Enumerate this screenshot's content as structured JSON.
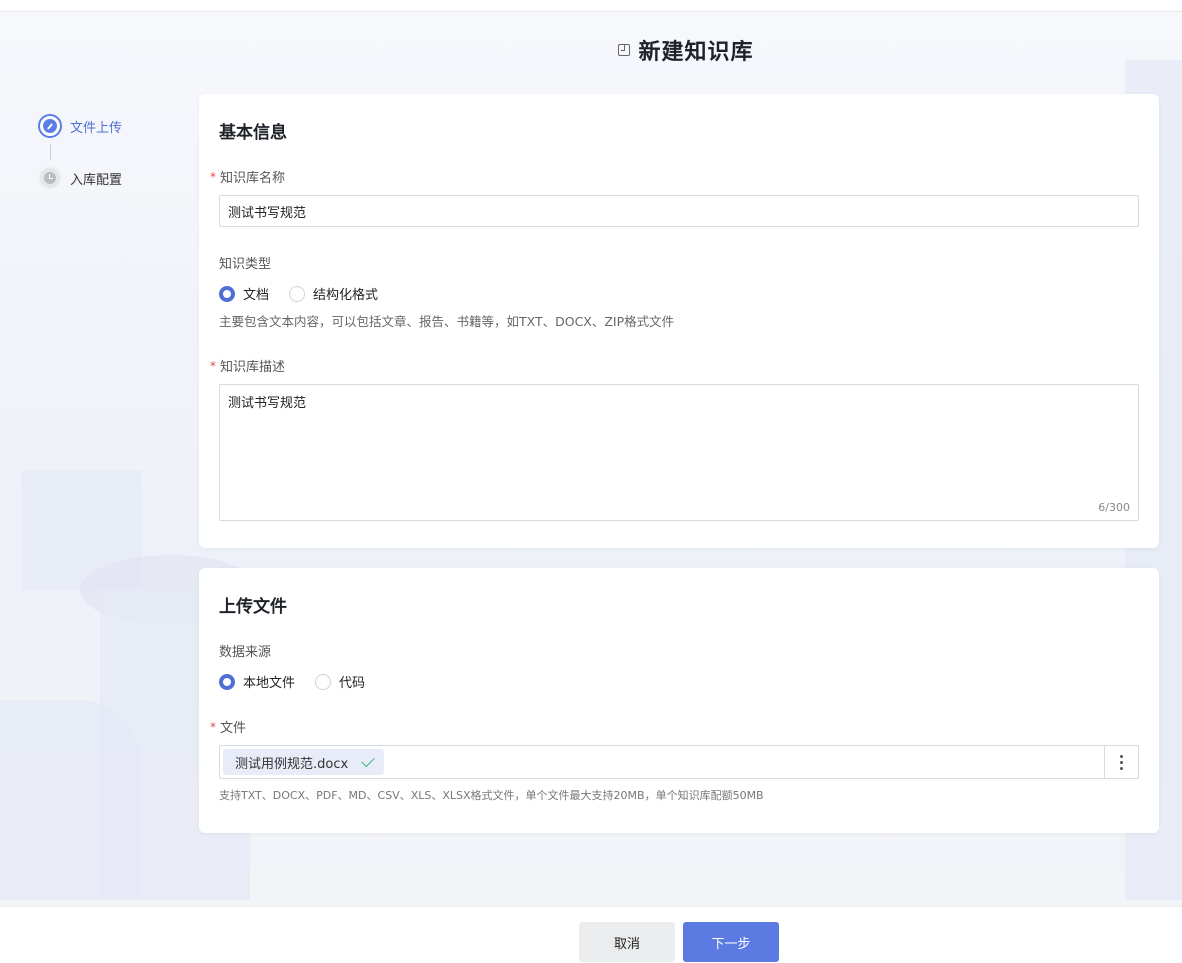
{
  "page": {
    "title": "新建知识库"
  },
  "steps": [
    {
      "label": "文件上传",
      "state": "active",
      "icon": "pencil-icon"
    },
    {
      "label": "入库配置",
      "state": "pending",
      "icon": "clock-icon"
    }
  ],
  "basic_info": {
    "heading": "基本信息",
    "name": {
      "label": "知识库名称",
      "required_mark": "*",
      "value": "测试书写规范"
    },
    "type": {
      "label": "知识类型",
      "options": [
        {
          "label": "文档",
          "checked": true
        },
        {
          "label": "结构化格式",
          "checked": false
        }
      ],
      "hint": "主要包含文本内容，可以包括文章、报告、书籍等，如TXT、DOCX、ZIP格式文件"
    },
    "description": {
      "label": "知识库描述",
      "required_mark": "*",
      "value": "测试书写规范",
      "counter": "6/300"
    }
  },
  "upload": {
    "heading": "上传文件",
    "source": {
      "label": "数据来源",
      "options": [
        {
          "label": "本地文件",
          "checked": true
        },
        {
          "label": "代码",
          "checked": false
        }
      ]
    },
    "file": {
      "label": "文件",
      "required_mark": "*",
      "filename": "测试用例规范.docx",
      "hint": "支持TXT、DOCX、PDF、MD、CSV、XLS、XLSX格式文件，单个文件最大支持20MB，单个知识库配额50MB"
    }
  },
  "footer": {
    "cancel_label": "取消",
    "next_label": "下一步"
  },
  "colors": {
    "accent": "#5b7be3",
    "required": "#e5484d",
    "success": "#3fb27f"
  }
}
